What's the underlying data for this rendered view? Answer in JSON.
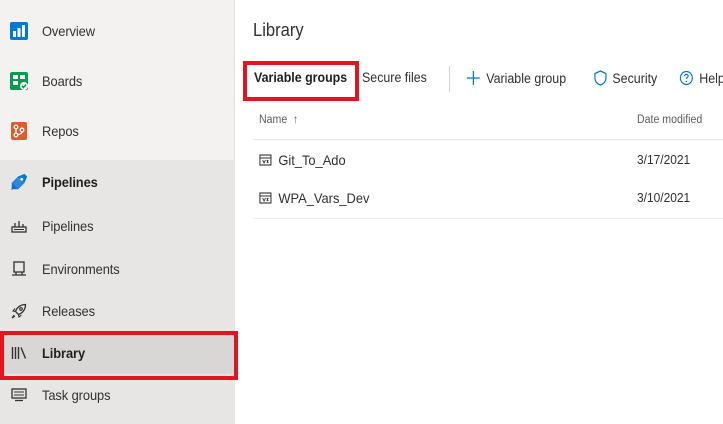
{
  "sidebar": {
    "items": [
      {
        "label": "Overview",
        "icon": "overview-icon"
      },
      {
        "label": "Boards",
        "icon": "boards-icon"
      },
      {
        "label": "Repos",
        "icon": "repos-icon"
      },
      {
        "label": "Pipelines",
        "icon": "pipelines-icon"
      },
      {
        "label": "Pipelines",
        "icon": "pipelines-sub-icon"
      },
      {
        "label": "Environments",
        "icon": "environments-icon"
      },
      {
        "label": "Releases",
        "icon": "rocket-icon"
      },
      {
        "label": "Library",
        "icon": "library-icon"
      },
      {
        "label": "Task groups",
        "icon": "task-groups-icon"
      }
    ],
    "selected": "Library"
  },
  "main": {
    "title": "Library",
    "toolbar": {
      "tab_variable_groups": "Variable groups",
      "tab_secure_files": "Secure files",
      "add_variable_group": "Variable group",
      "security": "Security",
      "help": "Help"
    },
    "table": {
      "col_name": "Name",
      "col_name_sort": "↑",
      "col_date": "Date modified",
      "rows": [
        {
          "name": "Git_To_Ado",
          "date": "3/17/2021"
        },
        {
          "name": "WPA_Vars_Dev",
          "date": "3/10/2021"
        }
      ]
    }
  },
  "colors": {
    "highlight_red": "#e3141f",
    "azure_blue": "#0078d4",
    "boards_green": "#009e49",
    "repos_orange": "#e05b2b",
    "sidebar_bg": "#f3f2f1"
  }
}
